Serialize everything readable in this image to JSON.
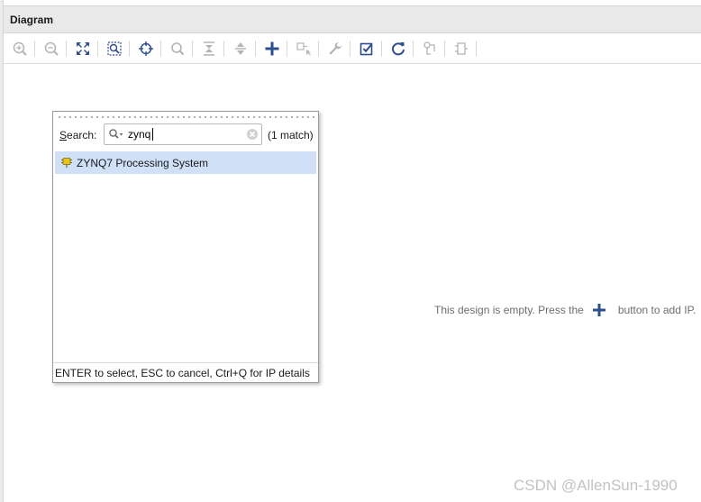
{
  "panel": {
    "title": "Diagram"
  },
  "toolbar": {
    "buttons": [
      {
        "icon": "zoom-in-icon",
        "enabled": false
      },
      {
        "icon": "zoom-out-icon",
        "enabled": false
      },
      {
        "icon": "zoom-fit-icon",
        "enabled": true
      },
      {
        "icon": "zoom-area-icon",
        "enabled": true
      },
      {
        "icon": "center-icon",
        "enabled": true
      },
      {
        "icon": "search-icon",
        "enabled": false
      },
      {
        "icon": "collapse-all-icon",
        "enabled": false
      },
      {
        "icon": "expand-all-icon",
        "enabled": false
      },
      {
        "icon": "add-ip-icon",
        "enabled": true
      },
      {
        "icon": "make-connection-icon",
        "enabled": false
      },
      {
        "icon": "wrench-icon",
        "enabled": false
      },
      {
        "icon": "validate-design-icon",
        "enabled": true
      },
      {
        "icon": "refresh-icon",
        "enabled": true
      },
      {
        "icon": "optimize-routing-icon",
        "enabled": false
      },
      {
        "icon": "pin-icon",
        "enabled": false
      }
    ]
  },
  "canvas": {
    "empty_message_before": "This design is empty. Press the",
    "empty_message_after": "button to add IP."
  },
  "ip_search_popup": {
    "search_label_mnemonic": "S",
    "search_label_rest": "earch:",
    "search_value": "zynq",
    "match_count": "(1 match)",
    "results": [
      {
        "label": "ZYNQ7 Processing System",
        "selected": true,
        "icon": "ip-chip-icon"
      }
    ],
    "footer_hint": "ENTER to select, ESC to cancel, Ctrl+Q for IP details"
  },
  "watermark": "CSDN @AllenSun-1990",
  "colors": {
    "accent_blue": "#2e4d8f",
    "selection": "#cfe0f7",
    "disabled_icon": "#b4b4b4",
    "chip_yellow": "#e8c21a"
  }
}
